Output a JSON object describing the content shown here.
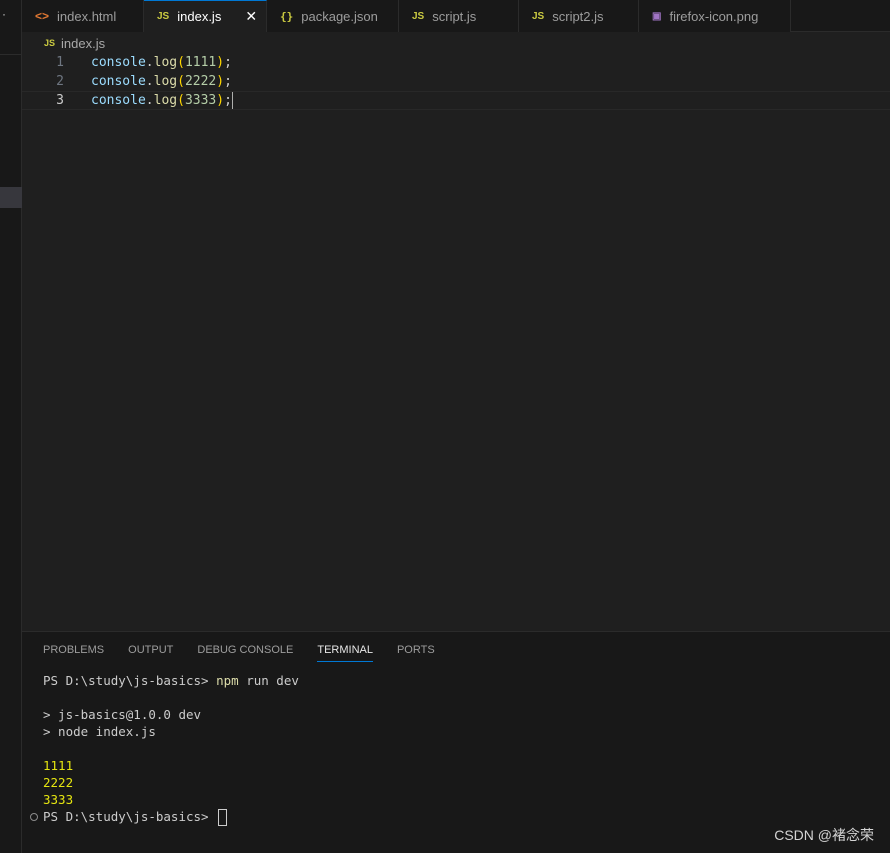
{
  "sidebar": {
    "dot": "·"
  },
  "tabs": [
    {
      "label": "index.html",
      "icon": "html-file-icon",
      "glyph": "<>"
    },
    {
      "label": "index.js",
      "icon": "js-file-icon",
      "glyph": "JS",
      "active": true,
      "close": "✕"
    },
    {
      "label": "package.json",
      "icon": "json-file-icon",
      "glyph": "{}"
    },
    {
      "label": "script.js",
      "icon": "js-file-icon",
      "glyph": "JS"
    },
    {
      "label": "script2.js",
      "icon": "js-file-icon",
      "glyph": "JS"
    },
    {
      "label": "firefox-icon.png",
      "icon": "image-file-icon",
      "glyph": "▣"
    }
  ],
  "breadcrumb": {
    "glyph": "JS",
    "file": "index.js"
  },
  "editor": {
    "lines": [
      {
        "num": "1",
        "obj": "console",
        "dot": ".",
        "fn": "log",
        "open": "(",
        "arg": "1111",
        "close": ")",
        "semi": ";"
      },
      {
        "num": "2",
        "obj": "console",
        "dot": ".",
        "fn": "log",
        "open": "(",
        "arg": "2222",
        "close": ")",
        "semi": ";"
      },
      {
        "num": "3",
        "obj": "console",
        "dot": ".",
        "fn": "log",
        "open": "(",
        "arg": "3333",
        "close": ")",
        "semi": ";"
      }
    ]
  },
  "panel": {
    "tabs": [
      "PROBLEMS",
      "OUTPUT",
      "DEBUG CONSOLE",
      "TERMINAL",
      "PORTS"
    ],
    "active_tab": "TERMINAL",
    "terminal": {
      "prompt1": "PS D:\\study\\js-basics> ",
      "cmd": "npm",
      "cmd_args": " run dev",
      "script1": "> js-basics@1.0.0 dev",
      "script2": "> node index.js",
      "out1": "1111",
      "out2": "2222",
      "out3": "3333",
      "prompt2": "PS D:\\study\\js-basics> "
    }
  },
  "watermark": "CSDN @褚念荣",
  "colors": {
    "accent": "#0078d4",
    "js_icon": "#cbcb41",
    "html_icon": "#e37933",
    "terminal_output": "#e5e510"
  }
}
